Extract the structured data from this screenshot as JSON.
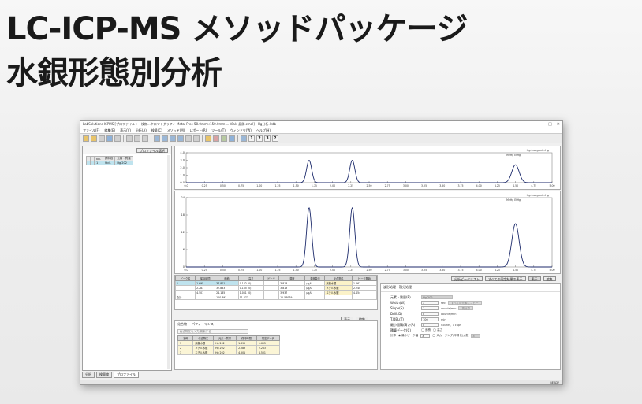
{
  "headline": {
    "line1": "LC-ICP-MS メソッドパッケージ",
    "line2": "水銀形態別分析"
  },
  "window": {
    "title": "LabSolutions ICPMS [プロファイル : 一検無...クロマトグラフィ Metal Free 50.0mm×150.0mm ...-Vials 展開.cmol] - Hg分析.lcdb",
    "controls": [
      "–",
      "□",
      "✕"
    ]
  },
  "menu": [
    "ファイル(F)",
    "編集(E)",
    "表示(V)",
    "分析(A)",
    "検量(C)",
    "メソッド(M)",
    "レポート(R)",
    "ツール(T)",
    "ウィンドウ(W)",
    "ヘルプ(H)"
  ],
  "toolbar": {
    "icons": [
      "open-icon",
      "new-icon",
      "save-icon",
      "print-icon",
      "preview-icon",
      "cut-icon",
      "copy-icon",
      "paste-icon",
      "grid-icon",
      "table-icon",
      "sheet-icon",
      "list-icon",
      "undo-icon",
      "settings-icon",
      "palette-icon",
      "flag-icon",
      "chart-icon",
      "monitor-icon"
    ],
    "numbered": [
      "1",
      "2",
      "3"
    ],
    "help": "?"
  },
  "sample_panel": {
    "button": "プロファイル選択",
    "headers": [
      "",
      "",
      "No.",
      "試料名",
      "元素・質量"
    ],
    "rows": [
      [
        "",
        "",
        "1",
        "Std1",
        "Hg 202"
      ]
    ]
  },
  "chart_top": {
    "legend": "Hg-inorganic-Hg",
    "legend2": "MeHg     EtHg",
    "y_ticks": [
      "4.0",
      "3.0",
      "2.0",
      "1.0",
      "0.0"
    ],
    "x_ticks": [
      "0.0",
      "0.25",
      "0.50",
      "0.75",
      "1.00",
      "1.25",
      "1.50",
      "1.75",
      "2.00",
      "2.25",
      "2.50",
      "2.75",
      "3.00",
      "3.25",
      "3.50",
      "3.75",
      "4.00",
      "4.25",
      "4.50",
      "4.75",
      "5.00"
    ]
  },
  "chart_bottom": {
    "legend": "Hg-inorganic-Hg",
    "legend2": "MeHg     EtHg",
    "y_ticks": [
      "24",
      "18",
      "12",
      "6",
      "0"
    ],
    "x_ticks": [
      "0.0",
      "0.25",
      "0.50",
      "0.75",
      "1.00",
      "1.25",
      "1.50",
      "1.75",
      "2.00",
      "2.25",
      "2.50",
      "2.75",
      "3.00",
      "3.25",
      "3.50",
      "3.75",
      "4.00",
      "4.25",
      "4.50",
      "4.75",
      "5.00"
    ]
  },
  "chart_data": {
    "type": "line",
    "x": [
      0.0,
      5.0
    ],
    "xlim": [
      0,
      5
    ],
    "series": [
      {
        "name": "Hg-inorganic-Hg",
        "peaks": [
          {
            "center": 1.68,
            "width": 0.035,
            "height_top": 3.0,
            "height_bottom": 20.5
          },
          {
            "center": 2.27,
            "width": 0.035,
            "height_top": 3.0,
            "height_bottom": 20.5
          },
          {
            "center": 4.5,
            "width": 0.05,
            "height_top": 2.4,
            "height_bottom": 15.0
          }
        ]
      }
    ],
    "ylim_top": [
      0,
      4
    ],
    "ylim_bottom": [
      0,
      24
    ]
  },
  "results": {
    "headers": [
      "ピーク名",
      "保持時間",
      "面積",
      "高さ",
      "ピーク",
      "濃度",
      "濃度単位",
      "化合物名",
      "ピーク開始"
    ],
    "rows": [
      [
        "1",
        "1.695",
        "37.801",
        "0.182 (0)",
        "",
        "3.813",
        "μg/L",
        "無機水銀",
        "1.667"
      ],
      [
        "",
        "2.283",
        "37.883",
        "0.165 (0)",
        "",
        "3.813",
        "μg/L",
        "メチル水銀",
        "2.240"
      ],
      [
        "",
        "4.501",
        "24.185",
        "1.061 (0)",
        "",
        "3.937",
        "μg/L",
        "エチル水銀",
        "4.454"
      ],
      [
        "合計",
        "",
        "100.893",
        "11.873",
        "",
        "11.56079",
        "",
        "",
        ""
      ]
    ]
  },
  "btns_mid": {
    "show": "表示",
    "edit": "編集"
  },
  "btns_top": {
    "peak_list": "分析ピークリスト",
    "all_peaks": "すべての同定結果の表示",
    "show": "表示",
    "edit": "編集"
  },
  "ions": {
    "tab1": "化合物",
    "tab2": "パフォーマンス",
    "placeholder": "化合物名を入力/検索する",
    "headers": [
      "名称",
      "化合物名",
      "元素・質量",
      "保持時間",
      "同定データ"
    ],
    "rows": [
      [
        "1",
        "無機水銀",
        "Hg 202",
        "1.695",
        "1.695"
      ],
      [
        "2",
        "メチル水銀",
        "Hg 202",
        "2.283",
        "2.283"
      ],
      [
        "3",
        "エチル水銀",
        "Hg 202",
        "4.501",
        "4.501"
      ]
    ]
  },
  "method": {
    "tab1": "波形処理",
    "tab2": "積分処理",
    "element_label": "元素・質量(E)",
    "element_value": "Hg 202",
    "rows": [
      {
        "label": "Width(W)",
        "value": "3",
        "unit": "sec",
        "button": "すべての元素にコピー"
      },
      {
        "label": "Slope(S)",
        "value": "1",
        "unit": "counts/min",
        "button": "再計算"
      },
      {
        "label": "Drift(D)",
        "value": "0",
        "unit": "counts/min",
        "button": ""
      },
      {
        "label": "T.DBL(T)",
        "value": "100",
        "unit": "min",
        "button": ""
      },
      {
        "label": "最小面積/高さ(A)",
        "value": "0",
        "unit": "Counts, 7 cups",
        "button": ""
      }
    ],
    "smoothing_label": "積算データ(C)",
    "radio1": "面積",
    "radio2": "高さ",
    "calc_label": "計算",
    "calc_opt1": "最小ピーク幅",
    "calc_val1": "3",
    "calc_opt2": "スムージング(平滑化)点数",
    "calc_val2": "3"
  },
  "tabs": [
    "分析",
    "検量線",
    "プロファイル"
  ],
  "status": "READY"
}
